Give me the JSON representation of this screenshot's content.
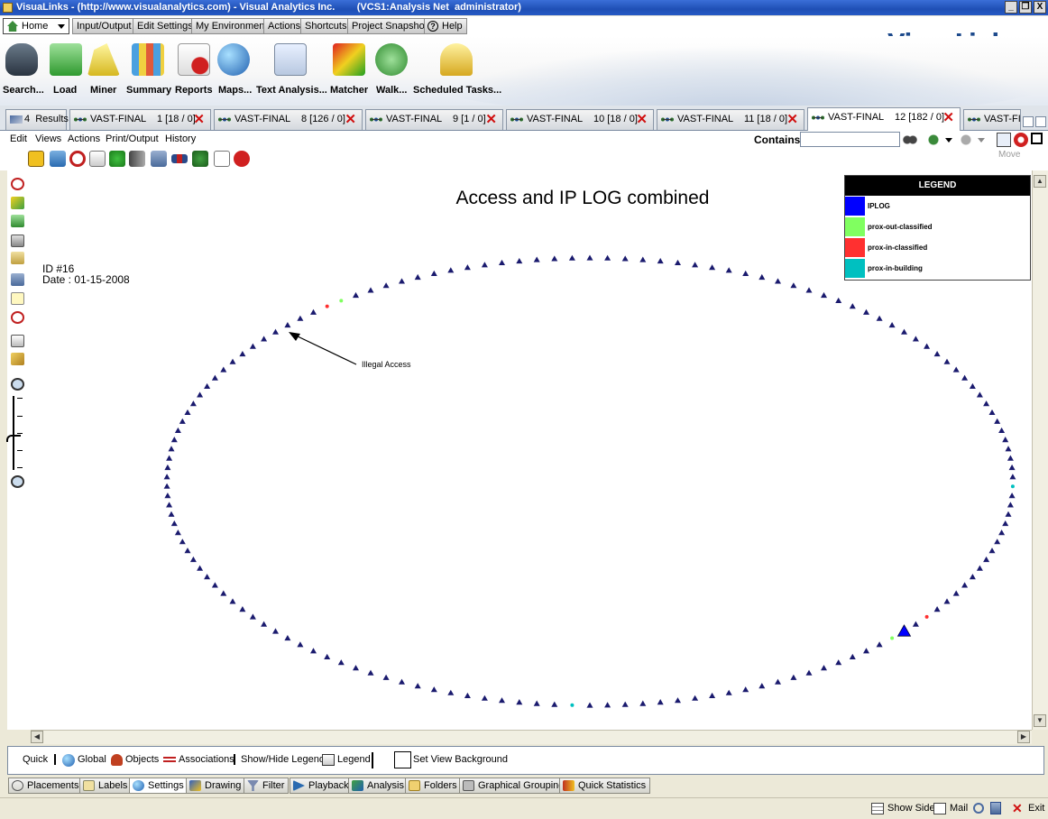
{
  "window": {
    "title": "VisuaLinks - (http://www.visualanalytics.com) - Visual Analytics Inc.        (VCS1:Analysis Net  administrator)",
    "buttons": [
      "_",
      "❐",
      "X"
    ]
  },
  "menubar": {
    "items": [
      "Home",
      "Input/Output",
      "Edit Settings",
      "My Environment",
      "Actions",
      "Shortcuts",
      "Project Snapshot",
      "Help"
    ]
  },
  "brand": "VisuaLinks",
  "ribbon": {
    "items": [
      "Search...",
      "Load",
      "Miner",
      "Summary",
      "Reports",
      "Maps...",
      "Text Analysis...",
      "Matcher",
      "Walk...",
      "Scheduled Tasks..."
    ]
  },
  "doc_tabs": [
    {
      "label": "4  Results"
    },
    {
      "label": "VAST-FINAL    1 [18 / 0]"
    },
    {
      "label": "VAST-FINAL    8 [126 / 0]"
    },
    {
      "label": "VAST-FINAL    9 [1 / 0]"
    },
    {
      "label": "VAST-FINAL    10 [18 / 0]"
    },
    {
      "label": "VAST-FINAL    11 [18 / 0]"
    },
    {
      "label": "VAST-FINAL    12 [182 / 0]"
    },
    {
      "label": "VAST-FIN..."
    }
  ],
  "submenu": {
    "items": [
      "Edit",
      "Views",
      "Actions",
      "Print/Output",
      "History"
    ],
    "contains_label": "Contains",
    "contains_value": "",
    "move_label": "Move"
  },
  "canvas": {
    "title": "Access and IP LOG combined",
    "id_label": "ID #16",
    "date_label": "Date : 01-15-2008",
    "annotation": "Illegal Access",
    "node_color": "#1a1a6e",
    "legend": {
      "title": "LEGEND",
      "items": [
        {
          "label": "IPLOG",
          "color": "#0000ff"
        },
        {
          "label": "prox-out-classified",
          "color": "#80ff60"
        },
        {
          "label": "prox-in-classified",
          "color": "#ff3030"
        },
        {
          "label": "prox-in-building",
          "color": "#00c0c0"
        }
      ]
    }
  },
  "bottom_toolbar": {
    "items": [
      "Quick",
      "Global",
      "Objects",
      "Associations",
      "Show/Hide Legend",
      "Legend",
      "Set View Background"
    ]
  },
  "bottom_tabs": [
    "Placements",
    "Labels",
    "Settings",
    "Drawing",
    "Filter",
    "Playback",
    "Analysis",
    "Folders",
    "Graphical Grouping",
    "Quick Statistics"
  ],
  "status": {
    "items": [
      "Show Side",
      "Mail",
      "Exit"
    ]
  }
}
